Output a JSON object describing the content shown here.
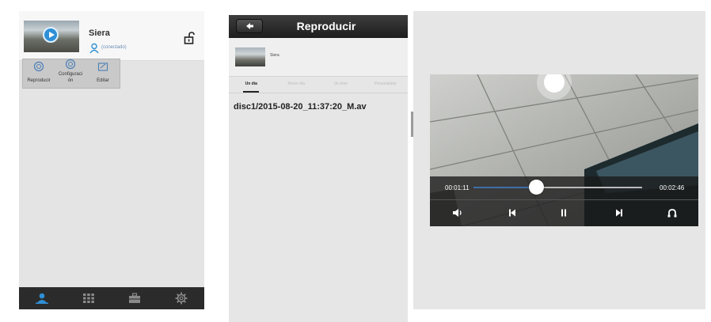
{
  "camera_list": {
    "camera_name": "Siera",
    "status": "(conectado)",
    "menu": [
      {
        "label": "Reproducir",
        "icon": "play-circle-icon"
      },
      {
        "label": "Configuraci ón",
        "icon": "settings-circle-icon"
      },
      {
        "label": "Editar",
        "icon": "edit-icon"
      }
    ],
    "bottom_tabs": [
      {
        "name": "user-icon",
        "active": true
      },
      {
        "name": "grid-icon",
        "active": false
      },
      {
        "name": "toolbox-icon",
        "active": false
      },
      {
        "name": "gear-icon",
        "active": false
      }
    ]
  },
  "playback": {
    "title": "Reproducir",
    "device_name": "Siera",
    "tabs": [
      "Un día",
      "Tercer día",
      "Un mes",
      "Personalizar"
    ],
    "active_tab": 0,
    "file": "disc1/2015-08-20_11:37:20_M.av"
  },
  "player": {
    "current_time": "00:01:11",
    "total_time": "00:02:46",
    "progress": 0.37,
    "paused": false
  },
  "colors": {
    "accent": "#2f8fd6",
    "progress": "#3f6fa8",
    "tabbar": "#2b2b2b",
    "header": "#2a2a2a"
  }
}
